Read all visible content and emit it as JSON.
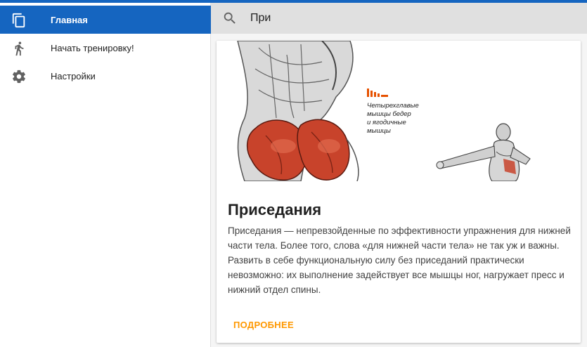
{
  "sidebar": {
    "items": [
      {
        "label": "Главная",
        "icon": "copy-icon",
        "active": true
      },
      {
        "label": "Начать тренировку!",
        "icon": "running-person-icon",
        "active": false
      },
      {
        "label": "Настройки",
        "icon": "gear-icon",
        "active": false
      }
    ]
  },
  "search": {
    "value": "При",
    "icon": "search-icon"
  },
  "card": {
    "image_caption": [
      "Четырехглавые",
      "мышцы бедер",
      "и ягодичные",
      "мышцы"
    ],
    "title": "Приседания",
    "description": "Приседания — непревзойденные по эффективности упражнения для нижней части тела. Более того, слова «для нижней части тела» не так уж и важны. Развить в себе функциональную силу без приседаний практически невозможно: их выполнение задействует все мышцы ног, нагружает пресс и нижний отдел спины.",
    "action_label": "ПОДРОБНЕЕ"
  },
  "colors": {
    "accent": "#1565c0",
    "action": "#ff9800",
    "caption_mark": "#e65100"
  }
}
